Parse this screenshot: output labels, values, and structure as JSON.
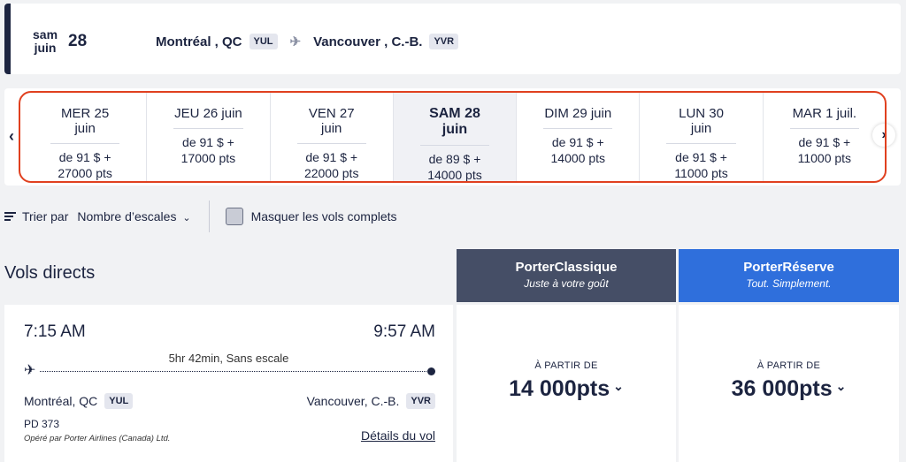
{
  "header": {
    "weekday_short": "sam",
    "month_short": "juin",
    "day": "28",
    "origin_city": "Montréal , QC",
    "origin_code": "YUL",
    "dest_city": "Vancouver , C.-B.",
    "dest_code": "YVR"
  },
  "carousel": {
    "days": [
      {
        "label": "MER 25 juin",
        "price": "de 91 $ +",
        "points": "27000 pts"
      },
      {
        "label": "JEU 26 juin",
        "price": "de 91 $ +",
        "points": "17000 pts"
      },
      {
        "label": "VEN 27 juin",
        "price": "de 91 $ +",
        "points": "22000 pts"
      },
      {
        "label": "SAM 28 juin",
        "price": "de 89 $ +",
        "points": "14000 pts"
      },
      {
        "label": "DIM 29 juin",
        "price": "de 91 $ +",
        "points": "14000 pts"
      },
      {
        "label": "LUN 30 juin",
        "price": "de 91 $ +",
        "points": "11000 pts"
      },
      {
        "label": "MAR 1 juil.",
        "price": "de 91 $ +",
        "points": "11000 pts"
      }
    ],
    "selected_index": 3
  },
  "sort": {
    "label": "Trier par",
    "value": "Nombre d’escales",
    "hide_full_label": "Masquer les vols complets"
  },
  "section": {
    "title": "Vols directs"
  },
  "fares": {
    "classic": {
      "name": "PorterClassique",
      "tagline": "Juste à votre goût",
      "from": "À PARTIR DE",
      "price": "14 000pts"
    },
    "reserve": {
      "name": "PorterRéserve",
      "tagline": "Tout. Simplement.",
      "from": "À PARTIR DE",
      "price": "36 000pts"
    }
  },
  "flight": {
    "dep_time": "7:15 AM",
    "arr_time": "9:57 AM",
    "duration": "5hr 42min, Sans escale",
    "dep_city": "Montréal, QC",
    "dep_code": "YUL",
    "arr_city": "Vancouver, C.-B.",
    "arr_code": "YVR",
    "flight_number": "PD 373",
    "operator": "Opéré par Porter Airlines (Canada) Ltd.",
    "details_label": "Détails du vol"
  },
  "colors": {
    "navy": "#1c2440",
    "classic_bg": "#454e66",
    "reserve_bg": "#2f6fdc",
    "highlight": "#e0401f"
  }
}
